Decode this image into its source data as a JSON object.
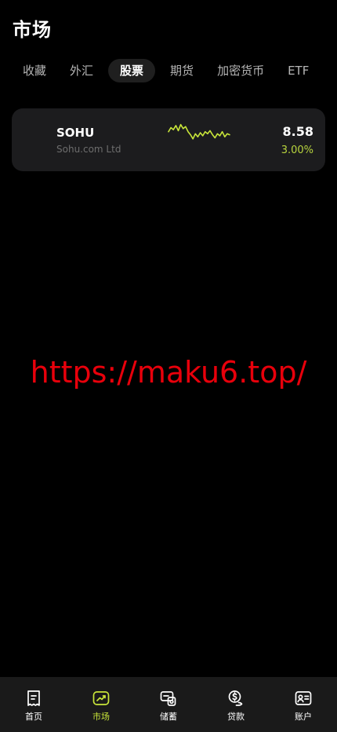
{
  "header": {
    "title": "市场"
  },
  "tabs": [
    {
      "label": "收藏"
    },
    {
      "label": "外汇"
    },
    {
      "label": "股票",
      "active": true
    },
    {
      "label": "期货"
    },
    {
      "label": "加密货币"
    },
    {
      "label": "ETF"
    }
  ],
  "stocks": [
    {
      "symbol": "SOHU",
      "company": "Sohu.com Ltd",
      "price": "8.58",
      "change": "3.00%",
      "trend_color": "#c9e63a",
      "sparkline": [
        0.55,
        0.75,
        0.65,
        0.85,
        0.6,
        0.9,
        0.7,
        0.8,
        0.55,
        0.4,
        0.2,
        0.45,
        0.3,
        0.5,
        0.35,
        0.55,
        0.45,
        0.6,
        0.4,
        0.25,
        0.45,
        0.35,
        0.55,
        0.3,
        0.45,
        0.4
      ]
    }
  ],
  "watermark": "https://maku6.top/",
  "bottom_nav": [
    {
      "label": "首页",
      "icon": "receipt-icon"
    },
    {
      "label": "市场",
      "icon": "market-trend-icon",
      "active": true
    },
    {
      "label": "储蓄",
      "icon": "savings-icon"
    },
    {
      "label": "贷款",
      "icon": "loan-icon"
    },
    {
      "label": "账户",
      "icon": "account-icon"
    }
  ],
  "colors": {
    "background": "#000000",
    "card": "#1c1c1e",
    "accent": "#c9e63a",
    "positive": "#b8d43e",
    "watermark": "#e8000b",
    "nav_background": "#1a1a1a"
  }
}
